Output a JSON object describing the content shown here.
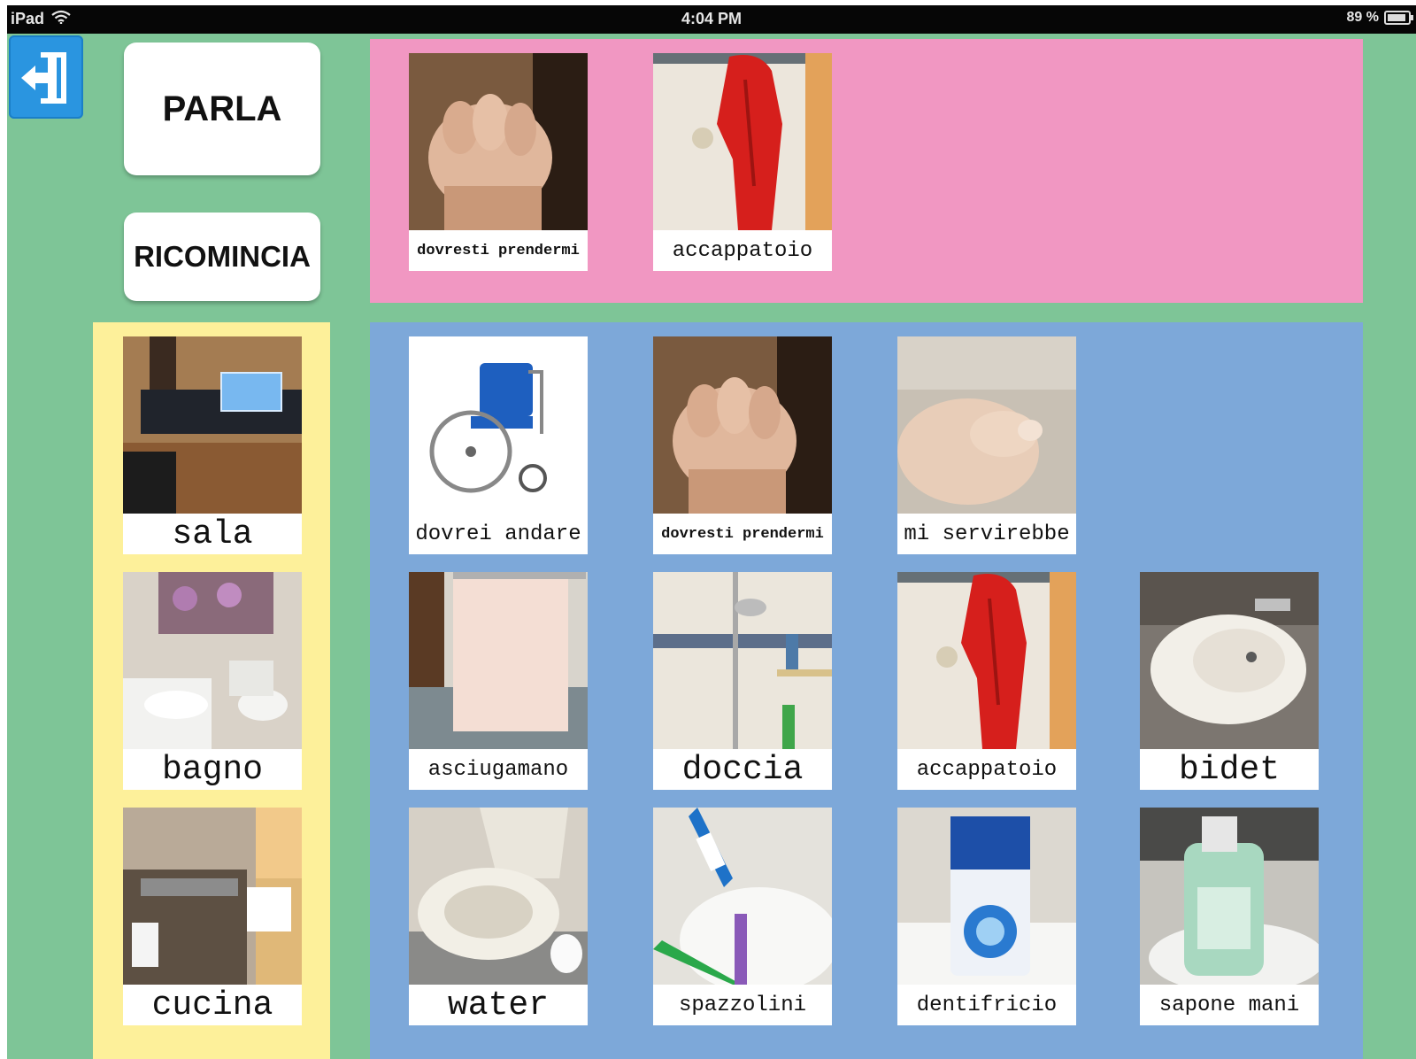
{
  "status_bar": {
    "device": "iPad",
    "time": "4:04 PM",
    "battery": "89 %",
    "battery_level": 0.89,
    "wifi_icon": "wifi-icon"
  },
  "toolbar": {
    "back_icon": "exit-arrow-icon",
    "speak_label": "PARLA",
    "restart_label": "RICOMINCIA"
  },
  "colors": {
    "background": "#7ec597",
    "phrase_strip": "#f197c2",
    "category_panel": "#fdf09a",
    "words_panel": "#7da8d9",
    "back_button": "#2a95e0"
  },
  "phrase": {
    "cards": [
      {
        "label": "dovresti prendermi",
        "image": "fist-gesture"
      },
      {
        "label": "accappatoio",
        "image": "red-bathrobe"
      }
    ]
  },
  "categories": [
    {
      "label": "sala",
      "image": "living-room"
    },
    {
      "label": "bagno",
      "image": "bathroom"
    },
    {
      "label": "cucina",
      "image": "kitchen"
    }
  ],
  "words": [
    {
      "label": "dovrei andare",
      "image": "wheelchair"
    },
    {
      "label": "dovresti prendermi",
      "image": "fist-gesture"
    },
    {
      "label": "mi servirebbe",
      "image": "hand-gesture"
    },
    {
      "label": "asciugamano",
      "image": "towel"
    },
    {
      "label": "doccia",
      "image": "shower"
    },
    {
      "label": "accappatoio",
      "image": "red-bathrobe"
    },
    {
      "label": "bidet",
      "image": "bidet"
    },
    {
      "label": "water",
      "image": "toilet"
    },
    {
      "label": "spazzolini",
      "image": "toothbrushes"
    },
    {
      "label": "dentifricio",
      "image": "toothpaste"
    },
    {
      "label": "sapone mani",
      "image": "hand-soap"
    }
  ]
}
